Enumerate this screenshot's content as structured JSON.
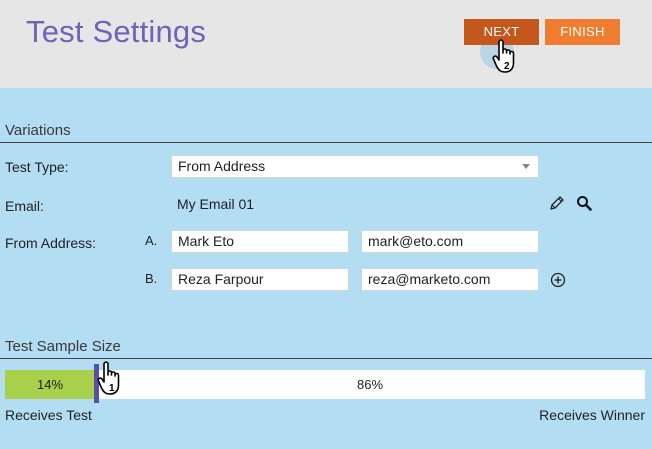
{
  "header": {
    "title": "Test Settings",
    "next_label": "NEXT",
    "finish_label": "FINISH"
  },
  "variations": {
    "section_title": "Variations",
    "test_type_label": "Test Type:",
    "test_type_value": "From Address",
    "email_label": "Email:",
    "email_value": "My Email 01",
    "from_address_label": "From Address:",
    "variants": [
      {
        "letter": "A.",
        "name": "Mark Eto",
        "email": "mark@eto.com"
      },
      {
        "letter": "B.",
        "name": "Reza Farpour",
        "email": "reza@marketo.com"
      }
    ]
  },
  "sample_size": {
    "section_title": "Test Sample Size",
    "test_percent": "14%",
    "test_fraction": 0.14,
    "winner_percent": "86%",
    "receives_test_label": "Receives Test",
    "receives_winner_label": "Receives Winner"
  },
  "cursors": [
    {
      "step": "2"
    },
    {
      "step": "1"
    }
  ],
  "icons": {
    "edit": "pencil-icon",
    "search": "search-icon",
    "add": "plus-circle-icon"
  },
  "colors": {
    "header_bg": "#e6e6e6",
    "body_bg": "#b3ddf2",
    "title": "#6f62b8",
    "next_button": "#c5571c",
    "finish_button": "#f07c2f",
    "test_bar": "#a8d04a",
    "slider_handle": "#5a4fa8"
  }
}
